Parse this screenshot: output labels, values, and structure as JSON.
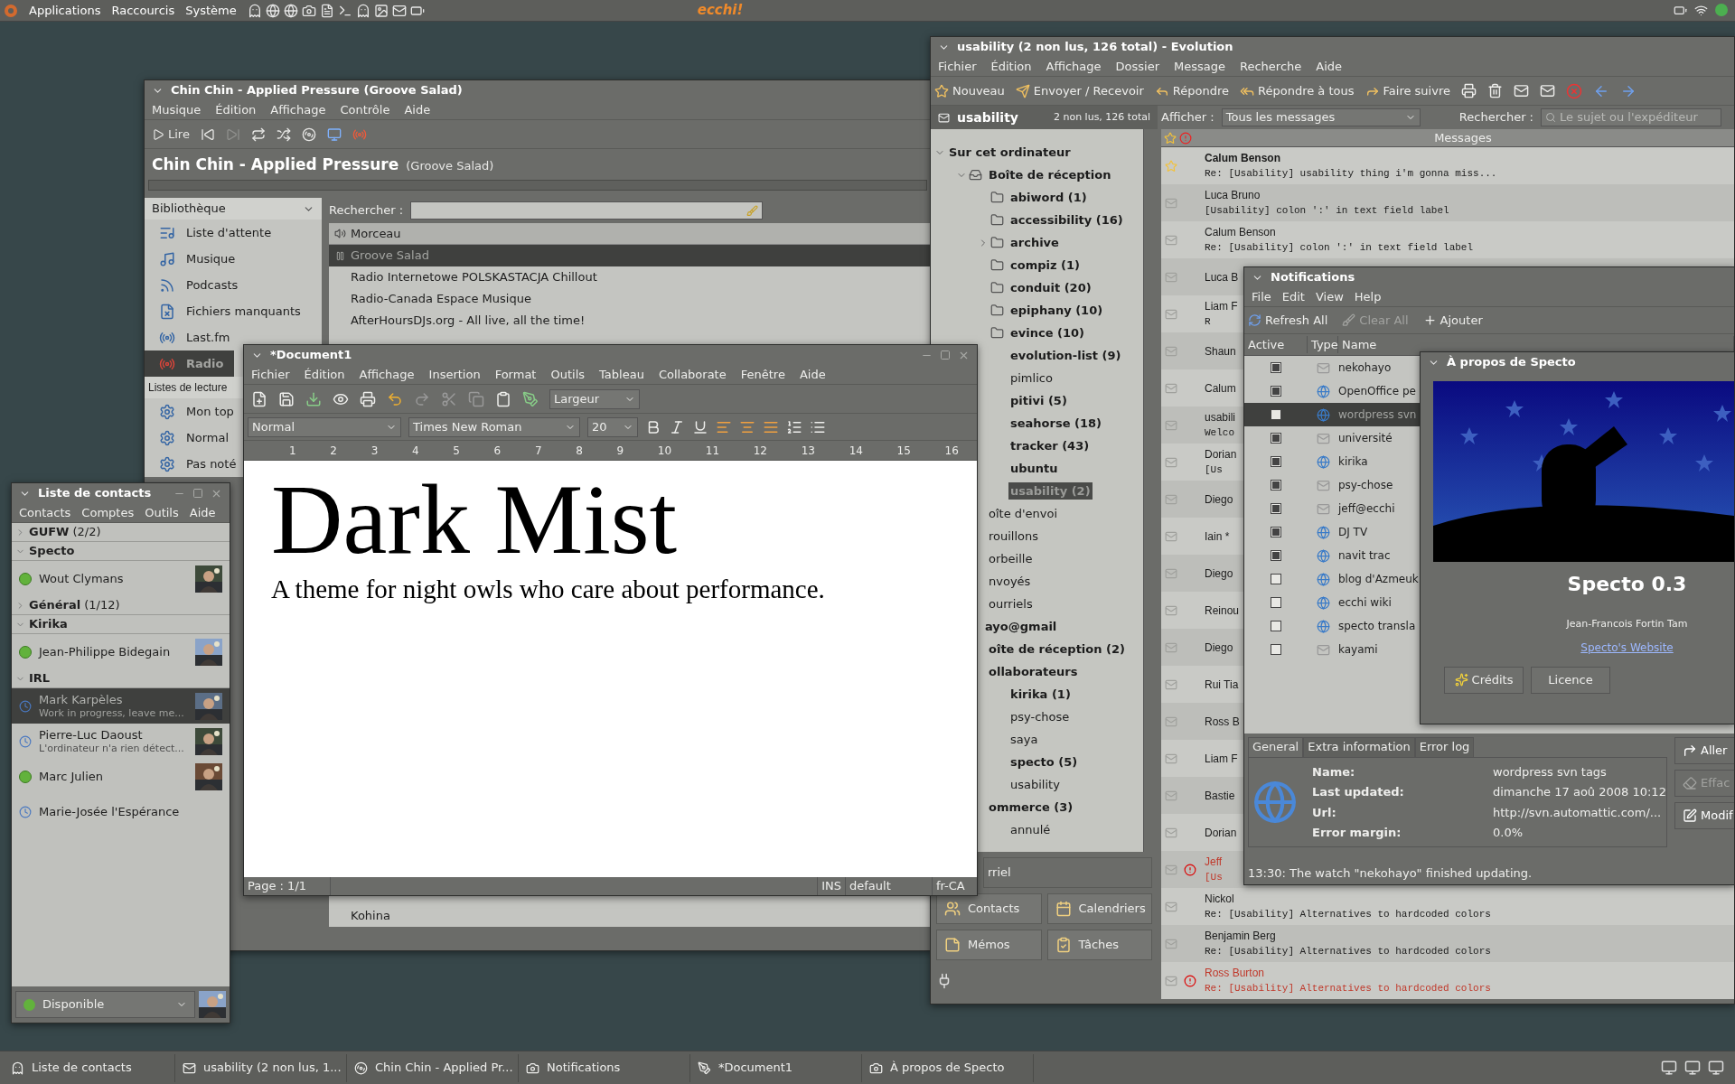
{
  "top_panel": {
    "menus": [
      "Applications",
      "Raccourcis",
      "Système"
    ],
    "applet_text": "ecchi!"
  },
  "rhythmbox": {
    "title": "Chin Chin - Applied Pressure (Groove Salad)",
    "menu": [
      "Musique",
      "Édition",
      "Affichage",
      "Contrôle",
      "Aide"
    ],
    "play_label": "Lire",
    "now_playing": {
      "track": "Chin Chin - Applied Pressure",
      "station": "(Groove Salad)"
    },
    "library_header": "Bibliothèque",
    "library": [
      {
        "label": "Liste d'attente",
        "kind": "queue",
        "selected": false
      },
      {
        "label": "Musique",
        "kind": "music",
        "selected": false
      },
      {
        "label": "Podcasts",
        "kind": "podcast",
        "selected": false
      },
      {
        "label": "Fichiers manquants",
        "kind": "missing",
        "selected": false
      },
      {
        "label": "Last.fm",
        "kind": "lastfm",
        "selected": false
      },
      {
        "label": "Radio",
        "kind": "radio",
        "selected": true
      }
    ],
    "playlists_header": "Listes de lecture",
    "playlists": [
      {
        "label": "Mon top",
        "selected": false
      },
      {
        "label": "Normal",
        "selected": false
      },
      {
        "label": "Pas noté",
        "selected": false
      }
    ],
    "search_label": "Rechercher :",
    "column": "Morceau",
    "tracks": [
      {
        "title": "Groove Salad",
        "playing": true,
        "selected": true
      },
      {
        "title": "Radio Internetowe POLSKASTACJA  Chillout",
        "playing": false,
        "selected": false
      },
      {
        "title": "Radio-Canada Espace Musique",
        "playing": false,
        "selected": false
      },
      {
        "title": "AfterHoursDJs.org - All live, all the time!",
        "playing": false,
        "selected": false
      }
    ],
    "last_track": {
      "title": "Kohina",
      "playing": false,
      "selected": false
    }
  },
  "evolution": {
    "title": "usability (2 non lus, 126 total) - Evolution",
    "menu": [
      "Fichier",
      "Édition",
      "Affichage",
      "Dossier",
      "Message",
      "Recherche",
      "Aide"
    ],
    "toolbar": [
      {
        "label": "Nouveau",
        "kind": "new"
      },
      {
        "label": "Envoyer / Recevoir",
        "kind": "send"
      },
      {
        "label": "Répondre",
        "kind": "reply"
      },
      {
        "label": "Répondre à tous",
        "kind": "reply_all"
      },
      {
        "label": "Faire suivre",
        "kind": "forward"
      }
    ],
    "folder_name": "usability",
    "folder_counts": "2 non lus, 126 total",
    "show_label": "Afficher :",
    "show_value": "Tous les messages",
    "search_label": "Rechercher :",
    "search_placeholder": "Le sujet ou l'expéditeur",
    "list_header": "Messages",
    "tree": [
      {
        "label": "Sur cet ordinateur",
        "unread": true,
        "expanded": true,
        "selected": false,
        "children": [
          {
            "label": "Boîte de réception",
            "kind": "inbox",
            "unread": true,
            "expanded": true,
            "selected": false,
            "children": [
              {
                "label": "abiword (1)",
                "kind": "folder",
                "unread": true,
                "selected": false
              },
              {
                "label": "accessibility (16)",
                "kind": "folder",
                "unread": true,
                "selected": false
              },
              {
                "label": "archive",
                "kind": "folder",
                "unread": true,
                "expanded": false,
                "selected": false
              },
              {
                "label": "compiz (1)",
                "kind": "folder",
                "unread": true,
                "selected": false
              },
              {
                "label": "conduit (20)",
                "kind": "folder",
                "unread": true,
                "selected": false
              },
              {
                "label": "epiphany (10)",
                "kind": "folder",
                "unread": true,
                "selected": false
              },
              {
                "label": "evince (10)",
                "kind": "folder",
                "unread": true,
                "selected": false
              },
              {
                "label": "evolution-list (9)",
                "unread": true,
                "selected": false
              },
              {
                "label": "pimlico",
                "unread": false,
                "selected": false
              },
              {
                "label": "pitivi (5)",
                "unread": true,
                "selected": false
              },
              {
                "label": "seahorse (18)",
                "unread": true,
                "selected": false
              },
              {
                "label": "tracker (43)",
                "unread": true,
                "selected": false
              },
              {
                "label": "ubuntu",
                "unread": true,
                "selected": false
              },
              {
                "label": "usability (2)",
                "unread": true,
                "selected": true
              }
            ]
          },
          {
            "label": "oîte d'envoi",
            "unread": false,
            "selected": false
          },
          {
            "label": "rouillons",
            "unread": false,
            "selected": false
          },
          {
            "label": "orbeille",
            "unread": false,
            "selected": false
          },
          {
            "label": "nvoyés",
            "unread": false,
            "selected": false
          },
          {
            "label": "ourriels",
            "unread": false,
            "selected": false
          }
        ]
      },
      {
        "label": "ayo@gmail",
        "unread": true,
        "selected": false,
        "children": [
          {
            "label": "oîte de réception (2)",
            "unread": true,
            "selected": false
          },
          {
            "label": "ollaborateurs",
            "unread": true,
            "selected": false,
            "children": [
              {
                "label": "kirika (1)",
                "unread": true,
                "selected": false
              },
              {
                "label": "psy-chose",
                "unread": false,
                "selected": false
              },
              {
                "label": "saya",
                "unread": false,
                "selected": false
              },
              {
                "label": "specto (5)",
                "unread": true,
                "selected": false
              },
              {
                "label": "usability",
                "unread": false,
                "selected": false
              }
            ]
          },
          {
            "label": "ommerce (3)",
            "unread": true,
            "selected": false,
            "children": [
              {
                "label": "annulé",
                "unread": false,
                "selected": false
              }
            ]
          }
        ]
      }
    ],
    "messages": [
      {
        "sender": "Calum Benson",
        "subject": "Re: [Usability] usability thing i'm gonna miss...",
        "unread": true,
        "important": false,
        "starred": true
      },
      {
        "sender": "Luca Bruno",
        "subject": "[Usability] colon ':' in text field label",
        "unread": false,
        "important": false,
        "starred": false
      },
      {
        "sender": "Calum Benson",
        "subject": "Re: [Usability] colon ':' in text field label",
        "unread": false,
        "important": false,
        "starred": false
      },
      {
        "sender": "Luca B",
        "unread": false,
        "important": false,
        "starred": false
      },
      {
        "sender": "Liam F",
        "subject": "R",
        "unread": false,
        "important": false,
        "starred": false
      },
      {
        "sender": "Shaun",
        "unread": false,
        "important": false,
        "starred": false
      },
      {
        "sender": "Calum",
        "unread": false,
        "important": false,
        "starred": false
      },
      {
        "sender": "usabili",
        "subject": "Welco",
        "unread": false,
        "important": false,
        "starred": false
      },
      {
        "sender": "Dorian",
        "subject": "[Us",
        "unread": false,
        "important": false,
        "starred": false
      },
      {
        "sender": "Diego",
        "unread": false,
        "important": false,
        "starred": false
      },
      {
        "sender": "Iain *",
        "unread": false,
        "important": false,
        "starred": false
      },
      {
        "sender": "Diego",
        "unread": false,
        "important": false,
        "starred": false
      },
      {
        "sender": "Reinou",
        "unread": false,
        "important": false,
        "starred": false
      },
      {
        "sender": "Diego",
        "unread": false,
        "important": false,
        "starred": false
      },
      {
        "sender": "Rui Tia",
        "unread": false,
        "important": false,
        "starred": false
      },
      {
        "sender": "Ross B",
        "unread": false,
        "important": false,
        "starred": false
      },
      {
        "sender": "Liam F",
        "unread": false,
        "important": false,
        "starred": false
      },
      {
        "sender": "Bastie",
        "unread": false,
        "important": false,
        "starred": false
      },
      {
        "sender": "Dorian",
        "unread": false,
        "important": false,
        "starred": false
      },
      {
        "sender": "Jeff",
        "subject": "[Us",
        "unread": false,
        "important": true,
        "starred": false
      },
      {
        "sender": "Nickol",
        "subject": "Re: [Usability] Alternatives to hardcoded colors",
        "unread": false,
        "important": false,
        "starred": false
      },
      {
        "sender": "Benjamin Berg",
        "subject": "Re: [Usability] Alternatives to hardcoded colors",
        "unread": false,
        "important": false,
        "starred": false
      },
      {
        "sender": "Ross Burton",
        "subject": "Re: [Usability] Alternatives to hardcoded colors",
        "unread": false,
        "important": true,
        "starred": false
      }
    ],
    "switcher_top": "rriel",
    "switcher": [
      {
        "label": "Contacts",
        "kind": "contacts"
      },
      {
        "label": "Calendriers",
        "kind": "calendar"
      },
      {
        "label": "Mémos",
        "kind": "memo"
      },
      {
        "label": "Tâches",
        "kind": "tasks"
      }
    ]
  },
  "document": {
    "title": "*Document1",
    "menu": [
      "Fichier",
      "Édition",
      "Affichage",
      "Insertion",
      "Format",
      "Outils",
      "Tableau",
      "Collaborate",
      "Fenêtre",
      "Aide"
    ],
    "zoom": "Largeur",
    "style": "Normal",
    "font": "Times New Roman",
    "size": "20",
    "ruler": [
      "1",
      "2",
      "3",
      "4",
      "5",
      "6",
      "7",
      "8",
      "9",
      "10",
      "11",
      "12",
      "13",
      "14",
      "15",
      "16"
    ],
    "heading": "Dark Mist",
    "paragraph": "A theme for night owls who care about performance.",
    "status": {
      "page": "Page : 1/1",
      "mode": "INS",
      "style": "default",
      "lang": "fr-CA"
    }
  },
  "contacts": {
    "title": "Liste de contacts",
    "menu": [
      "Contacts",
      "Comptes",
      "Outils",
      "Aide"
    ],
    "groups": [
      {
        "name": "GUFW",
        "count": "(2/2)",
        "expanded": false
      },
      {
        "name": "Specto",
        "expanded": true,
        "contacts": [
          {
            "name": "Wout Clymans",
            "kind": "available",
            "selected": false,
            "avatar": true
          }
        ]
      },
      {
        "name": "Général",
        "count": "(1/12)",
        "expanded": false
      },
      {
        "name": "Kirika",
        "expanded": true,
        "contacts": [
          {
            "name": "Jean-Philippe Bidegain",
            "kind": "available",
            "selected": false,
            "avatar": true
          }
        ]
      },
      {
        "name": "IRL",
        "expanded": true,
        "contacts": [
          {
            "name": "Mark Karpèles",
            "message": "Work in progress, leave me...",
            "kind": "away",
            "selected": true,
            "avatar": true
          },
          {
            "name": "Pierre-Luc Daoust",
            "message": "L'ordinateur n'a rien détect...",
            "kind": "away",
            "selected": false,
            "avatar": true
          },
          {
            "name": "Marc Julien",
            "kind": "available",
            "selected": false,
            "avatar": true
          },
          {
            "name": "Marie-Josée l'Espérance",
            "kind": "away",
            "selected": false,
            "avatar": false
          }
        ]
      }
    ],
    "presence_label": "Disponible"
  },
  "notifications": {
    "title": "Notifications",
    "menu": [
      "File",
      "Edit",
      "View",
      "Help"
    ],
    "refresh": "Refresh All",
    "clear": "Clear All",
    "clear_disabled": true,
    "add": "Ajouter",
    "columns": [
      "Active",
      "Type",
      "Name"
    ],
    "watches": [
      {
        "name": "nekohayo",
        "kind": "mail",
        "active": true,
        "selected": false
      },
      {
        "name": "OpenOffice pe",
        "kind": "web",
        "active": true,
        "selected": false
      },
      {
        "name": "wordpress svn",
        "kind": "web",
        "active": false,
        "selected": true
      },
      {
        "name": "université",
        "kind": "mail",
        "active": true,
        "selected": false
      },
      {
        "name": "kirika",
        "kind": "web",
        "active": true,
        "selected": false
      },
      {
        "name": "psy-chose",
        "kind": "mail",
        "active": true,
        "selected": false
      },
      {
        "name": "jeff@ecchi",
        "kind": "mail",
        "active": true,
        "selected": false
      },
      {
        "name": "DJ TV",
        "kind": "web",
        "active": true,
        "selected": false
      },
      {
        "name": "navit trac",
        "kind": "web",
        "active": true,
        "selected": false
      },
      {
        "name": "blog d'Azmeuk",
        "kind": "web",
        "active": false,
        "selected": false
      },
      {
        "name": "ecchi wiki",
        "kind": "web",
        "active": false,
        "selected": false
      },
      {
        "name": "specto transla",
        "kind": "web",
        "active": false,
        "selected": false
      },
      {
        "name": "kayami",
        "kind": "mail",
        "active": false,
        "selected": false
      }
    ],
    "tabs": [
      {
        "label": "General",
        "selected": true
      },
      {
        "label": "Extra information",
        "selected": false
      },
      {
        "label": "Error log",
        "selected": false
      }
    ],
    "details": [
      {
        "label": "Name:",
        "value": "wordpress svn tags"
      },
      {
        "label": "Last updated:",
        "value": "dimanche 17 aoû 2008 10:12"
      },
      {
        "label": "Url:",
        "value": "http://svn.automattic.com/..."
      },
      {
        "label": "Error margin:",
        "value": "0.0%"
      }
    ],
    "side_buttons": [
      {
        "label": "Aller",
        "disabled": false,
        "kind": "go"
      },
      {
        "label": "Effac",
        "disabled": true,
        "kind": "clear"
      },
      {
        "label": "Modif",
        "disabled": false,
        "kind": "edit"
      }
    ],
    "status": "13:30: The watch \"nekohayo\" finished updating."
  },
  "about": {
    "title": "À propos de Specto",
    "name": "Specto 0.3",
    "author": "Jean-Francois Fortin Tam",
    "link": "Specto's Website",
    "buttons": [
      {
        "label": "Crédits",
        "kind": "credits"
      },
      {
        "label": "Licence",
        "kind": "license"
      }
    ]
  },
  "taskbar": [
    {
      "label": "Liste de contacts",
      "kind": "chat"
    },
    {
      "label": "usability (2 non lus, 1...",
      "kind": "mail"
    },
    {
      "label": "Chin Chin - Applied Pr...",
      "kind": "music"
    },
    {
      "label": "Notifications",
      "kind": "specto"
    },
    {
      "label": "*Document1",
      "kind": "writer"
    },
    {
      "label": "À propos de Specto",
      "kind": "specto"
    }
  ]
}
